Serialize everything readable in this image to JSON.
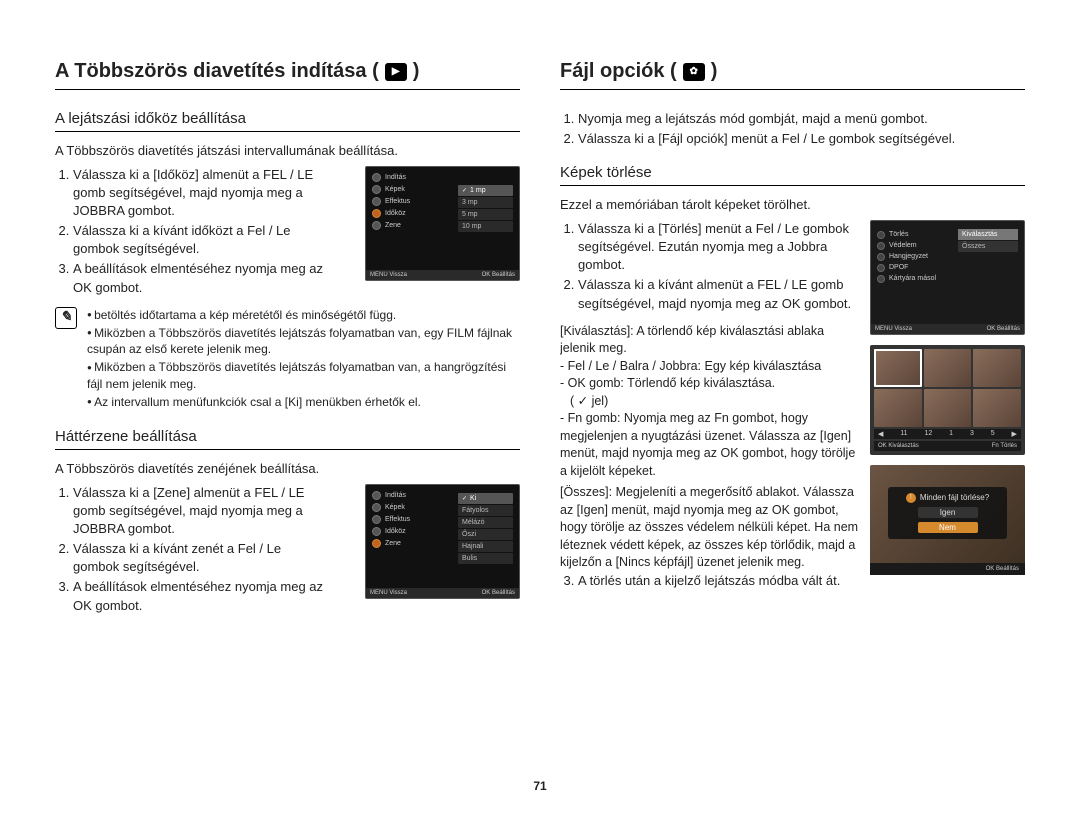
{
  "page_number": "71",
  "left": {
    "h1": "A Többszörös diavetítés indítása (",
    "h1_after": " )",
    "icon_play": "▶",
    "sec1": {
      "h2": "A lejátszási időköz beállítása",
      "intro": "A Többszörös diavetítés játszási intervallumának beállítása.",
      "steps": [
        "Válassza ki a [Időköz] almenüt a FEL / LE gomb segítségével, majd nyomja meg a JOBBRA gombot.",
        "Válassza ki a kívánt időközt a Fel / Le gombok segítségével.",
        "A beállítások elmentéséhez nyomja meg az OK gombot."
      ],
      "screen": {
        "items": [
          "Indítás",
          "Képek",
          "Effektus",
          "Időköz",
          "Zene"
        ],
        "selected": "Időköz",
        "sub": [
          "1 mp",
          "3 mp",
          "5 mp",
          "10 mp"
        ],
        "sub_selected": "1 mp",
        "footer_left": "Vissza",
        "footer_right": "Beállítás",
        "footer_left_key": "MENU",
        "footer_right_key": "OK"
      },
      "notes": [
        "betöltés időtartama a kép méretétől és minőségétől függ.",
        "Miközben a Többszörös diavetítés lejátszás folyamatban van, egy FILM fájlnak csupán az első kerete jelenik meg.",
        "Miközben a Többszörös diavetítés lejátszás folyamatban van, a hangrögzítési fájl nem jelenik meg.",
        "Az intervallum menüfunkciók csal a [Ki] menükben érhetők el."
      ]
    },
    "sec2": {
      "h2": "Háttérzene beállítása",
      "intro": "A Többszörös diavetítés zenéjének beállítása.",
      "steps": [
        "Válassza ki a [Zene] almenüt a FEL / LE gomb segítségével, majd nyomja meg a JOBBRA gombot.",
        "Válassza ki a kívánt zenét a Fel / Le gombok segítségével.",
        "A beállítások elmentéséhez nyomja meg az OK gombot."
      ],
      "screen": {
        "items": [
          "Indítás",
          "Képek",
          "Effektus",
          "Időköz",
          "Zene"
        ],
        "selected": "Zene",
        "sub": [
          "Ki",
          "Fátyolos",
          "Mélázó",
          "Őszi",
          "Hajnali",
          "Bulis"
        ],
        "sub_selected": "Ki",
        "footer_left": "Vissza",
        "footer_right": "Beállítás",
        "footer_left_key": "MENU",
        "footer_right_key": "OK"
      }
    }
  },
  "right": {
    "h1": "Fájl opciók (",
    "h1_after": " )",
    "icon_gear": "✿",
    "intro_steps": [
      "Nyomja meg a lejátszás mód gombját, majd a menü gombot.",
      "Válassza ki a [Fájl opciók] menüt a Fel / Le gombok segítségével."
    ],
    "sec1": {
      "h2": "Képek törlése",
      "intro": "Ezzel a memóriában tárolt képeket törölhet.",
      "screen1": {
        "items": [
          "Törlés",
          "Védelem",
          "Hangjegyzet",
          "DPOF",
          "Kártyára másol"
        ],
        "sub": [
          "Kiválasztás",
          "Összes"
        ],
        "sub_selected": "Kiválasztás",
        "footer_left": "Vissza",
        "footer_right": "Beállítás",
        "footer_left_key": "MENU",
        "footer_right_key": "OK"
      },
      "steps": [
        "Válassza ki a [Törlés] menüt a Fel / Le gombok segítségével. Ezután nyomja meg a Jobbra gombot.",
        "Válassza ki a kívánt almenüt a FEL / LE gomb segítségével, majd nyomja meg az OK gombot."
      ],
      "kival_label": "[Kiválasztás]",
      "kival_text": ": A törlendő kép kiválasztási ablaka jelenik meg.",
      "lines": [
        "- Fel / Le / Balra / Jobbra: Egy kép kiválasztása",
        "- OK gomb: Törlendő kép kiválasztása."
      ],
      "jel": "( ✓ jel)",
      "fn_line": "- Fn gomb: Nyomja meg az Fn gombot, hogy megjelenjen a nyugtázási üzenet. Válassza az [Igen] menüt, majd nyomja meg az OK gombot, hogy törölje a kijelölt képeket.",
      "osszes_label": "[Összes]",
      "osszes_text": ": Megjeleníti a megerősítő ablakot. Válassza az [Igen] menüt, majd nyomja meg az OK gombot, hogy törölje az összes védelem nélküli képet. Ha nem léteznek védett képek, az összes kép törlődik, majd a kijelzőn a [Nincs képfájl] üzenet jelenik meg.",
      "step3": "A törlés után a kijelző lejátszás módba vált át.",
      "thumb_nav": [
        "◀",
        "11",
        "12",
        "1",
        "3",
        "5",
        "▶"
      ],
      "thumb_footer_left": "Kiválasztás",
      "thumb_footer_left_key": "OK",
      "thumb_footer_right": "Törlés",
      "thumb_footer_right_key": "Fn",
      "confirm_q": "Minden fájl törlése?",
      "confirm_yes": "Igen",
      "confirm_no": "Nem",
      "confirm_footer_right": "Beállítás",
      "confirm_footer_right_key": "OK"
    }
  }
}
